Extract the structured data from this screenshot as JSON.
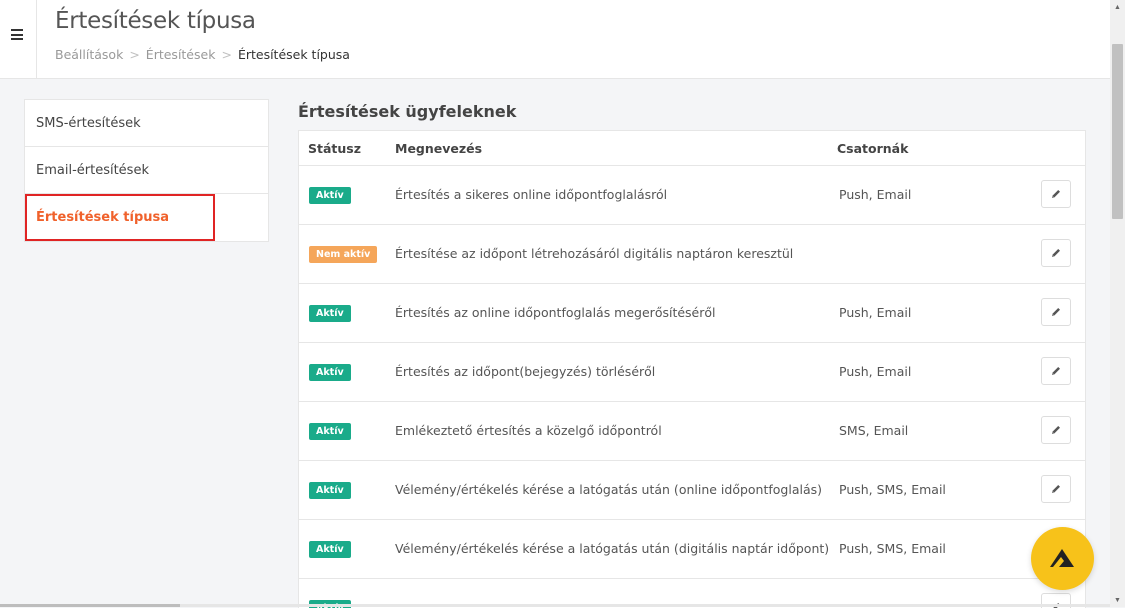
{
  "header": {
    "title": "Értesítések típusa",
    "breadcrumb": {
      "items": [
        "Beállítások",
        "Értesítések"
      ],
      "separator": ">",
      "current": "Értesítések típusa"
    }
  },
  "sidebar": {
    "items": [
      {
        "label": "SMS-értesítések"
      },
      {
        "label": "Email-értesítések"
      },
      {
        "label": "Értesítések típusa",
        "active": true
      }
    ]
  },
  "main": {
    "section_title": "Értesítések ügyfeleknek",
    "columns": {
      "status": "Státusz",
      "name": "Megnevezés",
      "channels": "Csatornák"
    },
    "rows": [
      {
        "status": "Aktív",
        "active": true,
        "name": "Értesítés a sikeres online időpontfoglalásról",
        "channels": "Push, Email"
      },
      {
        "status": "Nem aktív",
        "active": false,
        "name": "Értesítése az időpont létrehozásáról digitális naptáron keresztül",
        "channels": ""
      },
      {
        "status": "Aktív",
        "active": true,
        "name": "Értesítés az online időpontfoglalás megerősítéséről",
        "channels": "Push, Email"
      },
      {
        "status": "Aktív",
        "active": true,
        "name": "Értesítés az időpont(bejegyzés) törléséről",
        "channels": "Push, Email"
      },
      {
        "status": "Aktív",
        "active": true,
        "name": "Emlékeztető értesítés a közelgő időpontról",
        "channels": "SMS, Email"
      },
      {
        "status": "Aktív",
        "active": true,
        "name": "Vélemény/értékelés kérése a latógatás után (online időpontfoglalás)",
        "channels": "Push, SMS, Email"
      },
      {
        "status": "Aktív",
        "active": true,
        "name": "Vélemény/értékelés kérése a latógatás után (digitális naptár időpont)",
        "channels": "Push, SMS, Email"
      },
      {
        "status": "Aktív",
        "active": true,
        "name": "",
        "channels": ""
      }
    ]
  },
  "colors": {
    "active_badge": "#1aab8a",
    "inactive_badge": "#f5a65a",
    "sidebar_active_text": "#f0612b",
    "highlight_border": "#e02424",
    "fab": "#f7c21a"
  },
  "icons": {
    "menu": "hamburger-icon",
    "edit": "pencil-icon",
    "fab": "logo-icon"
  }
}
